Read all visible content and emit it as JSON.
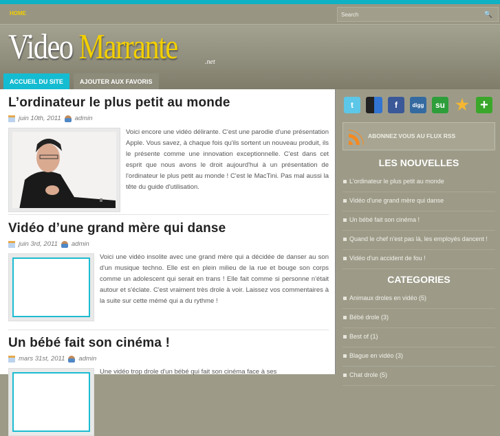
{
  "nav": {
    "home": "HOME",
    "search_placeholder": "Search"
  },
  "logo": {
    "word1": "Video",
    "word2": "Marrante",
    "suffix": ".net"
  },
  "tabs": [
    {
      "label": "ACCUEIL DU SITE"
    },
    {
      "label": "AJOUTER AUX FAVORIS"
    }
  ],
  "posts": [
    {
      "title": "L’ordinateur le plus petit au monde",
      "date": "juin 10th, 2011",
      "author": "admin",
      "excerpt": "Voici encore une vidéo délirante. C'est une parodie d'une présentation Apple. Vous savez, à chaque fois qu'ils sortent un nouveau produit, ils le présente comme une innovation exceptionnelle. C'est dans cet esprit que nous avons le droit aujourd'hui à un présentation de l'ordinateur le plus petit au monde ! C'est le MacTini. Pas mal aussi la tête du guide d'utilisation."
    },
    {
      "title": "Vidéo d’une grand mère qui danse",
      "date": "juin 3rd, 2011",
      "author": "admin",
      "excerpt": "Voici une vidéo insolite avec une grand mère qui a décidée de danser au son d'un musique techno. Elle est en plein milieu de la rue et bouge son corps comme un adolescent qui serait en trans ! Elle fait comme si personne n'était autour et s'éclate. C'est vraiment très drole à voir. Laissez vos commentaires à la suite sur cette mémé qui a du rythme !"
    },
    {
      "title": "Un bébé fait son cinéma !",
      "date": "mars 31st, 2011",
      "author": "admin",
      "excerpt": "Une vidéo trop drole d'un bébé qui fait son cinéma face à ses"
    }
  ],
  "sidebar": {
    "social": [
      "twitter",
      "delicious",
      "facebook",
      "digg",
      "stumbleupon",
      "favorite",
      "add"
    ],
    "social_labels": {
      "digg": "digg",
      "stumbleupon": "su"
    },
    "rss": "ABONNEZ VOUS AU FLUX RSS",
    "news_title": "LES NOUVELLES",
    "news": [
      "L'ordinateur le plus petit au monde",
      "Vidéo d'une grand mère qui danse",
      "Un bébé fait son cinéma !",
      "Quand le chef n'est pas là, les employés dancent !",
      "Vidéo d'un accident de fou !"
    ],
    "categories_title": "CATEGORIES",
    "categories": [
      "Animaux droles en vidéo (5)",
      "Bébé drole (3)",
      "Best of (1)",
      "Blague en vidéo (3)",
      "Chat drole (5)"
    ]
  }
}
